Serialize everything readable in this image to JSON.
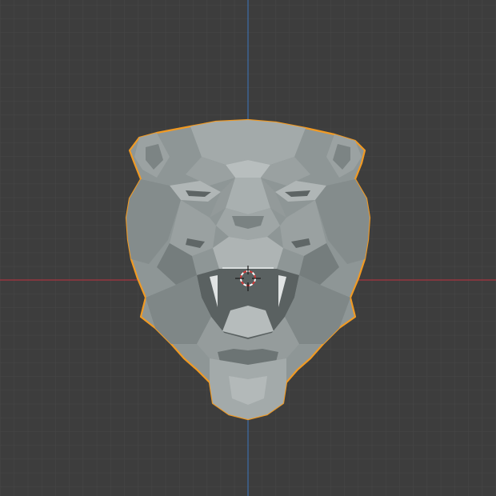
{
  "viewport": {
    "background": "#3d3d3d",
    "grid_minor_color": "#474747",
    "grid_major_color": "#525252",
    "x_axis_color": "#a8343f",
    "y_axis_color": "#3d6ea8"
  },
  "scene": {
    "selected_object": {
      "icon": "panther-head-mesh-icon",
      "outline_color": "#f09a24",
      "shading_color": "#8e9696",
      "selected": true
    },
    "cursor": {
      "icon": "3d-cursor-icon",
      "ring_colors": [
        "#ffffff",
        "#d43a3a"
      ]
    }
  }
}
